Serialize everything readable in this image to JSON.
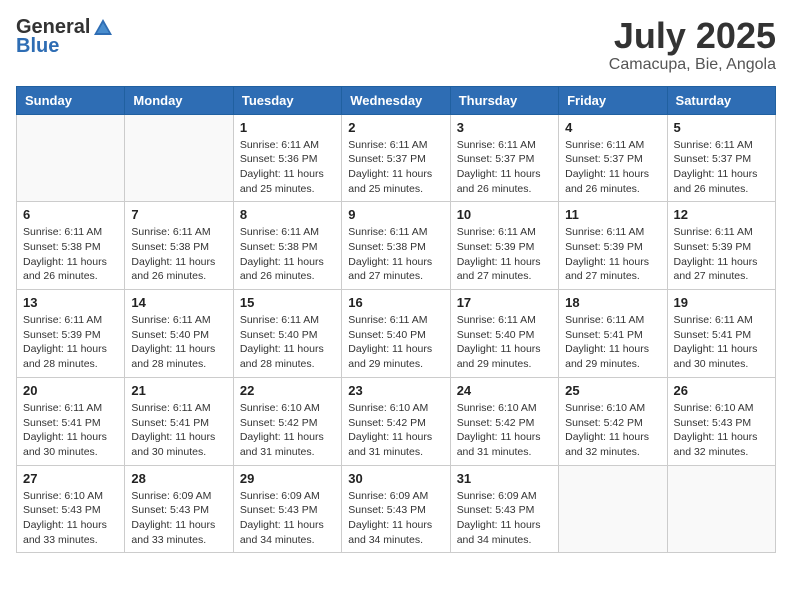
{
  "logo": {
    "general": "General",
    "blue": "Blue"
  },
  "title": "July 2025",
  "location": "Camacupa, Bie, Angola",
  "weekdays": [
    "Sunday",
    "Monday",
    "Tuesday",
    "Wednesday",
    "Thursday",
    "Friday",
    "Saturday"
  ],
  "weeks": [
    [
      {
        "day": "",
        "empty": true
      },
      {
        "day": "",
        "empty": true
      },
      {
        "day": "1",
        "sunrise": "Sunrise: 6:11 AM",
        "sunset": "Sunset: 5:36 PM",
        "daylight": "Daylight: 11 hours and 25 minutes."
      },
      {
        "day": "2",
        "sunrise": "Sunrise: 6:11 AM",
        "sunset": "Sunset: 5:37 PM",
        "daylight": "Daylight: 11 hours and 25 minutes."
      },
      {
        "day": "3",
        "sunrise": "Sunrise: 6:11 AM",
        "sunset": "Sunset: 5:37 PM",
        "daylight": "Daylight: 11 hours and 26 minutes."
      },
      {
        "day": "4",
        "sunrise": "Sunrise: 6:11 AM",
        "sunset": "Sunset: 5:37 PM",
        "daylight": "Daylight: 11 hours and 26 minutes."
      },
      {
        "day": "5",
        "sunrise": "Sunrise: 6:11 AM",
        "sunset": "Sunset: 5:37 PM",
        "daylight": "Daylight: 11 hours and 26 minutes."
      }
    ],
    [
      {
        "day": "6",
        "sunrise": "Sunrise: 6:11 AM",
        "sunset": "Sunset: 5:38 PM",
        "daylight": "Daylight: 11 hours and 26 minutes."
      },
      {
        "day": "7",
        "sunrise": "Sunrise: 6:11 AM",
        "sunset": "Sunset: 5:38 PM",
        "daylight": "Daylight: 11 hours and 26 minutes."
      },
      {
        "day": "8",
        "sunrise": "Sunrise: 6:11 AM",
        "sunset": "Sunset: 5:38 PM",
        "daylight": "Daylight: 11 hours and 26 minutes."
      },
      {
        "day": "9",
        "sunrise": "Sunrise: 6:11 AM",
        "sunset": "Sunset: 5:38 PM",
        "daylight": "Daylight: 11 hours and 27 minutes."
      },
      {
        "day": "10",
        "sunrise": "Sunrise: 6:11 AM",
        "sunset": "Sunset: 5:39 PM",
        "daylight": "Daylight: 11 hours and 27 minutes."
      },
      {
        "day": "11",
        "sunrise": "Sunrise: 6:11 AM",
        "sunset": "Sunset: 5:39 PM",
        "daylight": "Daylight: 11 hours and 27 minutes."
      },
      {
        "day": "12",
        "sunrise": "Sunrise: 6:11 AM",
        "sunset": "Sunset: 5:39 PM",
        "daylight": "Daylight: 11 hours and 27 minutes."
      }
    ],
    [
      {
        "day": "13",
        "sunrise": "Sunrise: 6:11 AM",
        "sunset": "Sunset: 5:39 PM",
        "daylight": "Daylight: 11 hours and 28 minutes."
      },
      {
        "day": "14",
        "sunrise": "Sunrise: 6:11 AM",
        "sunset": "Sunset: 5:40 PM",
        "daylight": "Daylight: 11 hours and 28 minutes."
      },
      {
        "day": "15",
        "sunrise": "Sunrise: 6:11 AM",
        "sunset": "Sunset: 5:40 PM",
        "daylight": "Daylight: 11 hours and 28 minutes."
      },
      {
        "day": "16",
        "sunrise": "Sunrise: 6:11 AM",
        "sunset": "Sunset: 5:40 PM",
        "daylight": "Daylight: 11 hours and 29 minutes."
      },
      {
        "day": "17",
        "sunrise": "Sunrise: 6:11 AM",
        "sunset": "Sunset: 5:40 PM",
        "daylight": "Daylight: 11 hours and 29 minutes."
      },
      {
        "day": "18",
        "sunrise": "Sunrise: 6:11 AM",
        "sunset": "Sunset: 5:41 PM",
        "daylight": "Daylight: 11 hours and 29 minutes."
      },
      {
        "day": "19",
        "sunrise": "Sunrise: 6:11 AM",
        "sunset": "Sunset: 5:41 PM",
        "daylight": "Daylight: 11 hours and 30 minutes."
      }
    ],
    [
      {
        "day": "20",
        "sunrise": "Sunrise: 6:11 AM",
        "sunset": "Sunset: 5:41 PM",
        "daylight": "Daylight: 11 hours and 30 minutes."
      },
      {
        "day": "21",
        "sunrise": "Sunrise: 6:11 AM",
        "sunset": "Sunset: 5:41 PM",
        "daylight": "Daylight: 11 hours and 30 minutes."
      },
      {
        "day": "22",
        "sunrise": "Sunrise: 6:10 AM",
        "sunset": "Sunset: 5:42 PM",
        "daylight": "Daylight: 11 hours and 31 minutes."
      },
      {
        "day": "23",
        "sunrise": "Sunrise: 6:10 AM",
        "sunset": "Sunset: 5:42 PM",
        "daylight": "Daylight: 11 hours and 31 minutes."
      },
      {
        "day": "24",
        "sunrise": "Sunrise: 6:10 AM",
        "sunset": "Sunset: 5:42 PM",
        "daylight": "Daylight: 11 hours and 31 minutes."
      },
      {
        "day": "25",
        "sunrise": "Sunrise: 6:10 AM",
        "sunset": "Sunset: 5:42 PM",
        "daylight": "Daylight: 11 hours and 32 minutes."
      },
      {
        "day": "26",
        "sunrise": "Sunrise: 6:10 AM",
        "sunset": "Sunset: 5:43 PM",
        "daylight": "Daylight: 11 hours and 32 minutes."
      }
    ],
    [
      {
        "day": "27",
        "sunrise": "Sunrise: 6:10 AM",
        "sunset": "Sunset: 5:43 PM",
        "daylight": "Daylight: 11 hours and 33 minutes."
      },
      {
        "day": "28",
        "sunrise": "Sunrise: 6:09 AM",
        "sunset": "Sunset: 5:43 PM",
        "daylight": "Daylight: 11 hours and 33 minutes."
      },
      {
        "day": "29",
        "sunrise": "Sunrise: 6:09 AM",
        "sunset": "Sunset: 5:43 PM",
        "daylight": "Daylight: 11 hours and 34 minutes."
      },
      {
        "day": "30",
        "sunrise": "Sunrise: 6:09 AM",
        "sunset": "Sunset: 5:43 PM",
        "daylight": "Daylight: 11 hours and 34 minutes."
      },
      {
        "day": "31",
        "sunrise": "Sunrise: 6:09 AM",
        "sunset": "Sunset: 5:43 PM",
        "daylight": "Daylight: 11 hours and 34 minutes."
      },
      {
        "day": "",
        "empty": true
      },
      {
        "day": "",
        "empty": true
      }
    ]
  ]
}
